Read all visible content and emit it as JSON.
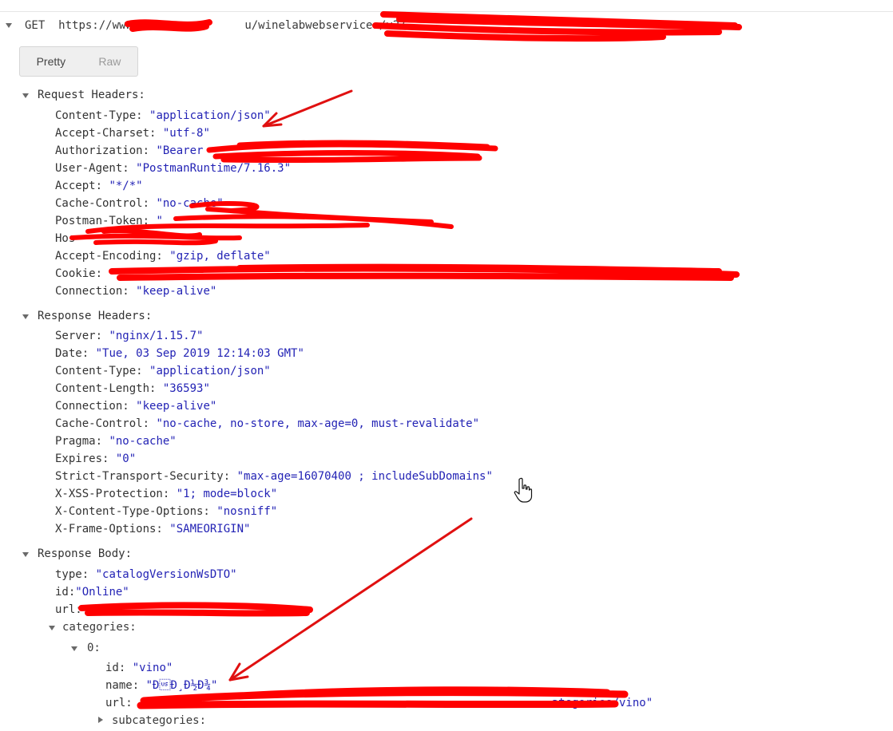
{
  "request_line": {
    "method": "GET",
    "url_visible": "https://www.",
    "url_tail": "u/winelabwebservices/v2/"
  },
  "view_toggle": {
    "pretty_label": "Pretty",
    "raw_label": "Raw",
    "selected": "Pretty"
  },
  "request_headers": {
    "title": "Request Headers:",
    "items": [
      {
        "key": "Content-Type:",
        "value": "\"application/json\""
      },
      {
        "key": "Accept-Charset:",
        "value": "\"utf-8\""
      },
      {
        "key": "Authorization:",
        "value": "\"Bearer"
      },
      {
        "key": "User-Agent:",
        "value": "\"PostmanRuntime/7.16.3\""
      },
      {
        "key": "Accept:",
        "value": "\"*/*\""
      },
      {
        "key": "Cache-Control:",
        "value": "\"no-cache\""
      },
      {
        "key": "Postman-Token:",
        "value": "\""
      },
      {
        "key": "Hos",
        "value": ""
      },
      {
        "key": "Accept-Encoding:",
        "value": "\"gzip, deflate\""
      },
      {
        "key": "Cookie:",
        "value": "\""
      },
      {
        "key": "Connection:",
        "value": "\"keep-alive\""
      }
    ]
  },
  "response_headers": {
    "title": "Response Headers:",
    "items": [
      {
        "key": "Server:",
        "value": "\"nginx/1.15.7\""
      },
      {
        "key": "Date:",
        "value": "\"Tue, 03 Sep 2019 12:14:03 GMT\""
      },
      {
        "key": "Content-Type:",
        "value": "\"application/json\""
      },
      {
        "key": "Content-Length:",
        "value": "\"36593\""
      },
      {
        "key": "Connection:",
        "value": "\"keep-alive\""
      },
      {
        "key": "Cache-Control:",
        "value": "\"no-cache, no-store, max-age=0, must-revalidate\""
      },
      {
        "key": "Pragma:",
        "value": "\"no-cache\""
      },
      {
        "key": "Expires:",
        "value": "\"0\""
      },
      {
        "key": "Strict-Transport-Security:",
        "value": "\"max-age=16070400 ; includeSubDomains\""
      },
      {
        "key": "X-XSS-Protection:",
        "value": "\"1; mode=block\""
      },
      {
        "key": "X-Content-Type-Options:",
        "value": "\"nosniff\""
      },
      {
        "key": "X-Frame-Options:",
        "value": "\"SAMEORIGIN\""
      }
    ]
  },
  "response_body": {
    "title": "Response Body:",
    "type_key": "type:",
    "type_value": "\"catalogVersionWsDTO\"",
    "id_key": "id:",
    "id_value": "\"Online\"",
    "url_key": "url:",
    "categories_label": "categories:",
    "index_label": "0:",
    "cat_id_key": "id:",
    "cat_id_value": "\"vino\"",
    "cat_name_key": "name:",
    "cat_name_value": "\"Ð\u001fÐ¸Ð½Ð¾\"",
    "cat_url_key": "url:",
    "cat_url_tail": "ategories/vino\"",
    "subcategories_label": "subcategories:"
  },
  "colors": {
    "key_text": "#333333",
    "string_value": "#2323b5",
    "redaction": "#ff0000",
    "annotation_arrow": "#e01010"
  }
}
